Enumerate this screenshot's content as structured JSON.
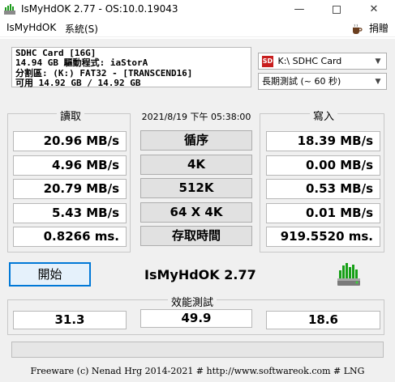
{
  "window": {
    "title": "IsMyHdOK 2.77 - OS:10.0.19043",
    "minimize_glyph": "—",
    "close_glyph": "✕"
  },
  "menu": {
    "items": [
      "IsMyHdOK",
      "系統(S)"
    ],
    "donate_label": "捐贈"
  },
  "drive_info": {
    "line1": "SDHC Card [16G]",
    "line2": "14.94 GB  驅動程式: iaStorA",
    "line3": "分割區: (K:) FAT32 - [TRANSCEND16]",
    "line4": "可用 14.92 GB / 14.92 GB"
  },
  "drive_select": {
    "value": "K:\\ SDHC Card",
    "icon_text": "SD"
  },
  "test_select": {
    "value": "長期測試 (~ 60 秒)"
  },
  "read": {
    "title": "讀取",
    "values": [
      "20.96 MB/s",
      "4.96 MB/s",
      "20.79 MB/s",
      "5.43 MB/s",
      "0.8266 ms."
    ]
  },
  "write": {
    "title": "寫入",
    "values": [
      "18.39 MB/s",
      "0.00 MB/s",
      "0.53 MB/s",
      "0.01 MB/s",
      "919.5520 ms."
    ]
  },
  "timestamp": "2021/8/19 下午 05:38:00",
  "test_labels": [
    "循序",
    "4K",
    "512K",
    "64 X 4K",
    "存取時間"
  ],
  "start_button": "開始",
  "app_label": "IsMyHdOK 2.77",
  "performance": {
    "title": "效能測試",
    "values": [
      "31.3",
      "49.9",
      "18.6"
    ]
  },
  "progress": {
    "fraction": 0.0
  },
  "footer": "Freeware (c) Nenad Hrg 2014-2021 # http://www.softwareok.com     # LNG",
  "colors": {
    "accent": "#0078d7",
    "progress_fill": "#06b025",
    "drive_icon": "#c81e1e"
  }
}
